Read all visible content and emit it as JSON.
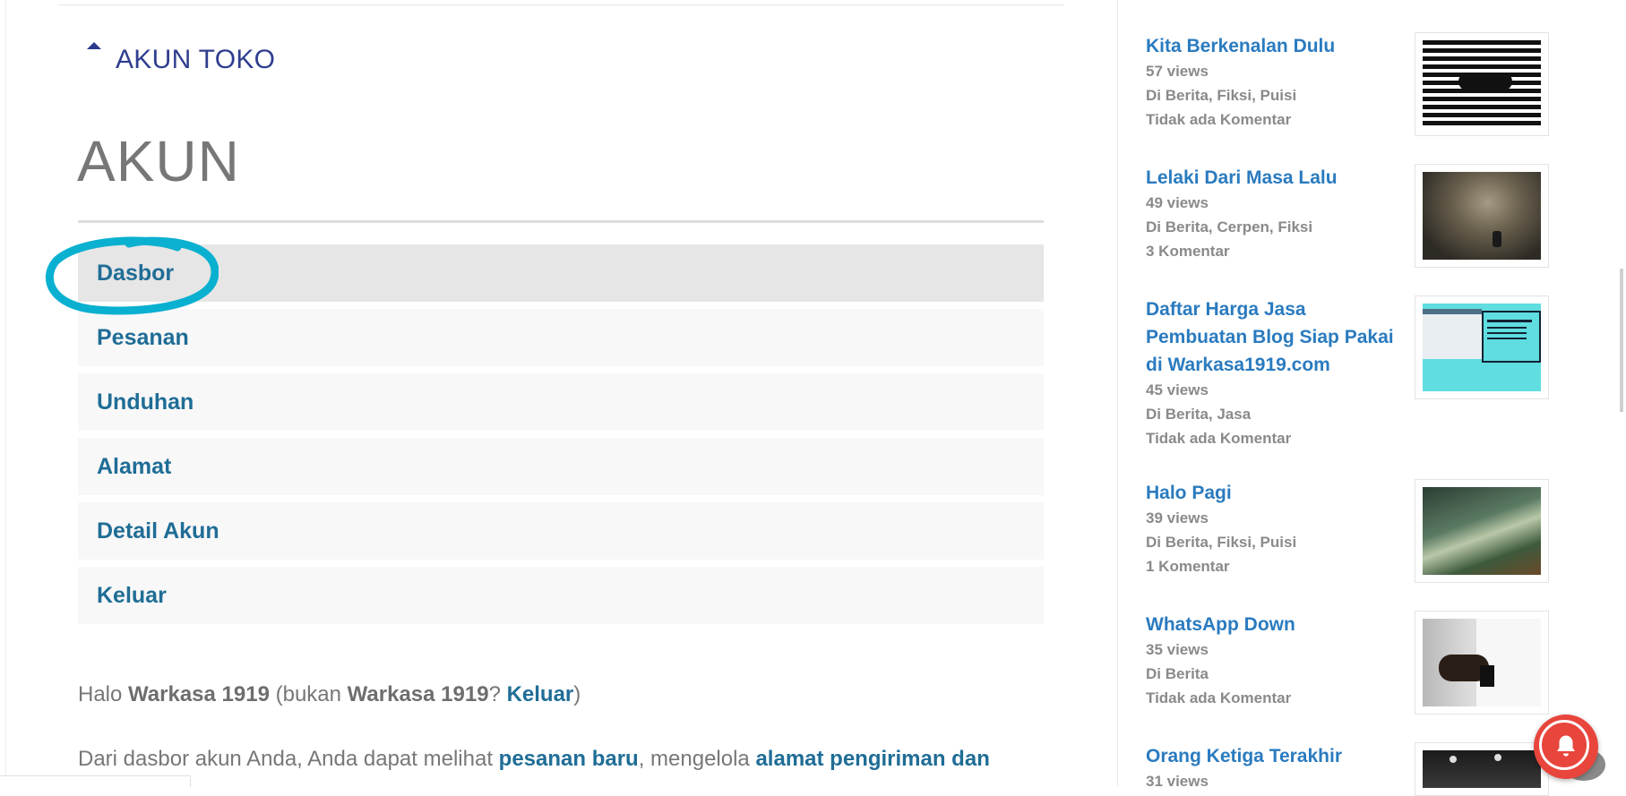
{
  "breadcrumb": {
    "label": "AKUN TOKO"
  },
  "page": {
    "title": "AKUN"
  },
  "nav": {
    "items": [
      {
        "label": "Dasbor"
      },
      {
        "label": "Pesanan"
      },
      {
        "label": "Unduhan"
      },
      {
        "label": "Alamat"
      },
      {
        "label": "Detail Akun"
      },
      {
        "label": "Keluar"
      }
    ]
  },
  "greeting": {
    "prefix": "Halo ",
    "user": "Warkasa 1919",
    "middle": " (bukan ",
    "user2": "Warkasa 1919",
    "q": "? ",
    "logout_link": "Keluar",
    "suffix": ")"
  },
  "desc": {
    "text1": "Dari dasbor akun Anda, Anda dapat melihat ",
    "link1": "pesanan baru",
    "text2": ", mengelola ",
    "link2": "alamat pengiriman dan"
  },
  "sidebar": {
    "posts": [
      {
        "title": "Kita Berkenalan Dulu",
        "views": "57 views",
        "categories": "Di Berita, Fiksi, Puisi",
        "comments": "Tidak ada Komentar"
      },
      {
        "title": "Lelaki Dari Masa Lalu",
        "views": "49 views",
        "categories": "Di Berita, Cerpen, Fiksi",
        "comments": "3 Komentar"
      },
      {
        "title": "Daftar Harga Jasa Pembuatan Blog Siap Pakai di Warkasa1919.com",
        "views": "45 views",
        "categories": "Di Berita, Jasa",
        "comments": "Tidak ada Komentar"
      },
      {
        "title": "Halo Pagi",
        "views": "39 views",
        "categories": "Di Berita, Fiksi, Puisi",
        "comments": "1 Komentar"
      },
      {
        "title": "WhatsApp Down",
        "views": "35 views",
        "categories": "Di Berita",
        "comments": "Tidak ada Komentar"
      },
      {
        "title": "Orang Ketiga Terakhir",
        "views": "31 views",
        "categories": "",
        "comments": ""
      }
    ]
  },
  "colors": {
    "link": "#1f6d96",
    "annotation": "#0ab0d0",
    "notification": "#e8453c"
  }
}
